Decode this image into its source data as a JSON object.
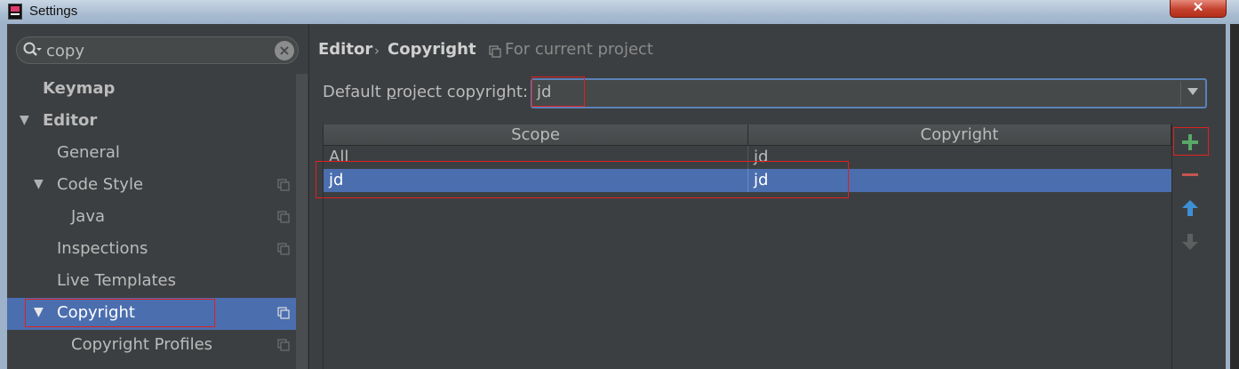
{
  "window": {
    "title": "Settings",
    "close_symbol": "✕"
  },
  "search": {
    "value": "copy",
    "clear_symbol": "×"
  },
  "tree": {
    "keymap": "Keymap",
    "editor": "Editor",
    "general": "General",
    "code_style": "Code Style",
    "java": "Java",
    "inspections": "Inspections",
    "live_templates": "Live Templates",
    "copyright": "Copyright",
    "copyright_profiles": "Copyright Profiles"
  },
  "breadcrumb": {
    "parent": "Editor",
    "separator": "›",
    "current": "Copyright",
    "scope_note": "For current project"
  },
  "default_copyright": {
    "label_before": "Default ",
    "label_accel": "p",
    "label_after": "roject copyright:",
    "value": "jd"
  },
  "table": {
    "headers": [
      "Scope",
      "Copyright"
    ],
    "rows": [
      {
        "scope": "All",
        "copyright": "jd"
      },
      {
        "scope": "jd",
        "copyright": "jd"
      }
    ]
  },
  "toolbar": {
    "add": "add",
    "remove": "remove",
    "move_up": "move-up",
    "move_down": "move-down"
  },
  "colors": {
    "selection": "#4b6eaf",
    "background": "#3c3f41",
    "add_green": "#59a869",
    "remove_red": "#c75450",
    "arrow_blue": "#3d8fd6",
    "annotation_red": "#e02020"
  }
}
